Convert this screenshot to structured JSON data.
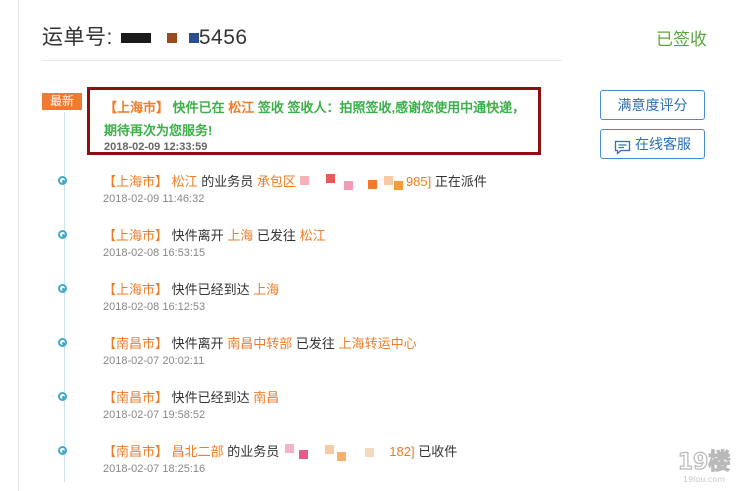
{
  "header": {
    "waybill_label": "运单号:",
    "waybill_suffix": "5456",
    "status": "已签收"
  },
  "latest": {
    "badge": "最新",
    "city": "【上海市】",
    "text_prefix": "快件已在",
    "place": "松江",
    "text_suffix": "签收 签收人：拍照签收,感谢您使用中通快递，期待再次为您服务!",
    "time": "2018-02-09 12:33:59"
  },
  "buttons": {
    "rate": "满意度评分",
    "service": "在线客服"
  },
  "events": [
    {
      "city": "【上海市】",
      "place": "松江",
      "mid": "的业务员",
      "place2": "承包区",
      "tail_code": "985]",
      "tail": "正在派件",
      "time": "2018-02-09 11:46:32"
    },
    {
      "city": "【上海市】",
      "text": "快件离开",
      "place": "上海",
      "mid": "已发往",
      "place2": "松江",
      "time": "2018-02-08 16:53:15"
    },
    {
      "city": "【上海市】",
      "text": "快件已经到达",
      "place": "上海",
      "time": "2018-02-08 16:12:53"
    },
    {
      "city": "【南昌市】",
      "text": "快件离开",
      "place": "南昌中转部",
      "mid": "已发往",
      "place2": "上海转运中心",
      "time": "2018-02-07 20:02:11"
    },
    {
      "city": "【南昌市】",
      "text": "快件已经到达",
      "place": "南昌",
      "time": "2018-02-07 19:58:52"
    },
    {
      "city": "【南昌市】",
      "place": "昌北二部",
      "mid": "的业务员",
      "tail_code": "182]",
      "tail": "已收件",
      "time": "2018-02-07 18:25:16"
    }
  ],
  "colors": {
    "accent_orange": "#ef7c28",
    "signed_green": "#5ba43c",
    "latest_green": "#3cb049",
    "highlight_border": "#8c0f14",
    "button_blue": "#2f6fb6",
    "timeline_blue": "#3fa9c6"
  },
  "icons": {
    "service": "chat-icon",
    "timeline": "timeline-dot-icon"
  },
  "watermark": {
    "text": "19楼",
    "sub": "19lou.com"
  }
}
